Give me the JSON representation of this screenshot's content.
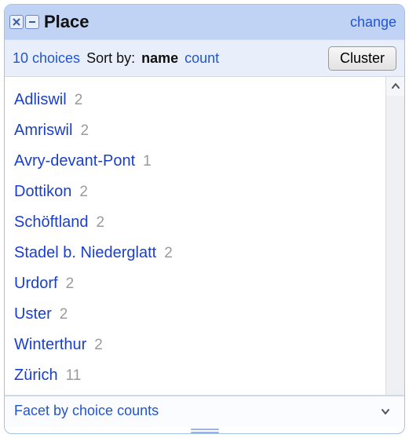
{
  "header": {
    "title": "Place",
    "change_label": "change"
  },
  "toolbar": {
    "choices_label": "10 choices",
    "sort_by_label": "Sort by:",
    "sort_options": {
      "name": "name",
      "count": "count"
    },
    "active_sort": "name",
    "cluster_label": "Cluster"
  },
  "items": [
    {
      "label": "Adliswil",
      "count": 2
    },
    {
      "label": "Amriswil",
      "count": 2
    },
    {
      "label": "Avry-devant-Pont",
      "count": 1
    },
    {
      "label": "Dottikon",
      "count": 2
    },
    {
      "label": "Schöftland",
      "count": 2
    },
    {
      "label": "Stadel b. Niederglatt",
      "count": 2
    },
    {
      "label": "Urdorf",
      "count": 2
    },
    {
      "label": "Uster",
      "count": 2
    },
    {
      "label": "Winterthur",
      "count": 2
    },
    {
      "label": "Zürich",
      "count": 11
    }
  ],
  "footer": {
    "link_label": "Facet by choice counts"
  }
}
